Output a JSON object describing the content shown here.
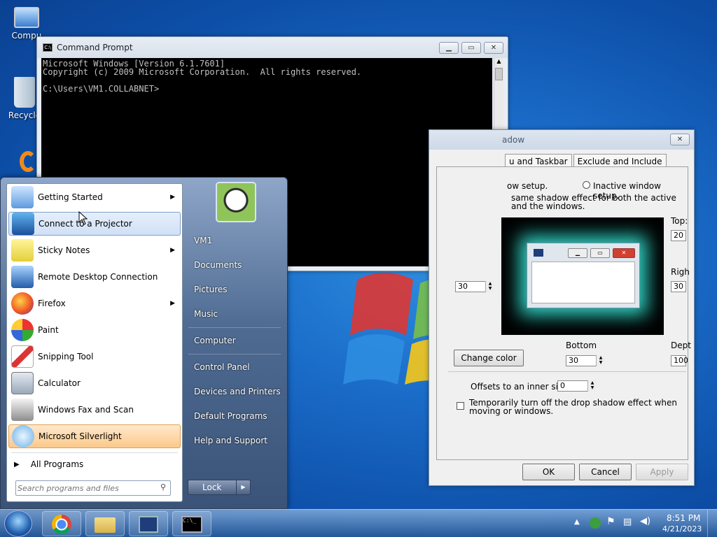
{
  "desktop": {
    "icons": [
      {
        "label": "Compu"
      },
      {
        "label": "Recycle"
      }
    ]
  },
  "cmd": {
    "title": "Command Prompt",
    "lines": [
      "Microsoft Windows [Version 6.1.7601]",
      "Copyright (c) 2009 Microsoft Corporation.  All rights reserved.",
      "",
      "C:\\Users\\VM1.COLLABNET>"
    ]
  },
  "dialog": {
    "title": "adow",
    "tabs": [
      "u and Taskbar",
      "Exclude and Include"
    ],
    "radio_active_tail": "ow setup.",
    "radio_inactive": "Inactive window setup.",
    "same_effect_text": "same shadow effect for both the active and the windows.",
    "top_label": "Top:",
    "top_value": "20",
    "right_label": "Righ",
    "right_value": "30",
    "left_value": "30",
    "bottom_label": "Bottom",
    "bottom_value": "30",
    "depth_label": "Dept",
    "depth_value": "100",
    "change_color": "Change color",
    "offsets_label": "Offsets to an inner side:",
    "offsets_value": "0",
    "temp_off": "Temporarily turn off the drop shadow effect when moving or windows.",
    "ok": "OK",
    "cancel": "Cancel",
    "apply": "Apply"
  },
  "start": {
    "programs": [
      {
        "label": "Getting Started",
        "arrow": "▶"
      },
      {
        "label": "Connect to a Projector",
        "arrow": ""
      },
      {
        "label": "Sticky Notes",
        "arrow": "▶"
      },
      {
        "label": "Remote Desktop Connection",
        "arrow": ""
      },
      {
        "label": "Firefox",
        "arrow": "▶"
      },
      {
        "label": "Paint",
        "arrow": ""
      },
      {
        "label": "Snipping Tool",
        "arrow": ""
      },
      {
        "label": "Calculator",
        "arrow": ""
      },
      {
        "label": "Windows Fax and Scan",
        "arrow": ""
      },
      {
        "label": "Microsoft Silverlight",
        "arrow": ""
      }
    ],
    "all_programs": "All Programs",
    "all_programs_arrow": "▶",
    "search_placeholder": "Search programs and files",
    "right": [
      "VM1",
      "Documents",
      "Pictures",
      "Music",
      "Computer",
      "Control Panel",
      "Devices and Printers",
      "Default Programs",
      "Help and Support"
    ],
    "lock": "Lock"
  },
  "taskbar": {
    "time": "8:51 PM",
    "date": "4/21/2023"
  }
}
